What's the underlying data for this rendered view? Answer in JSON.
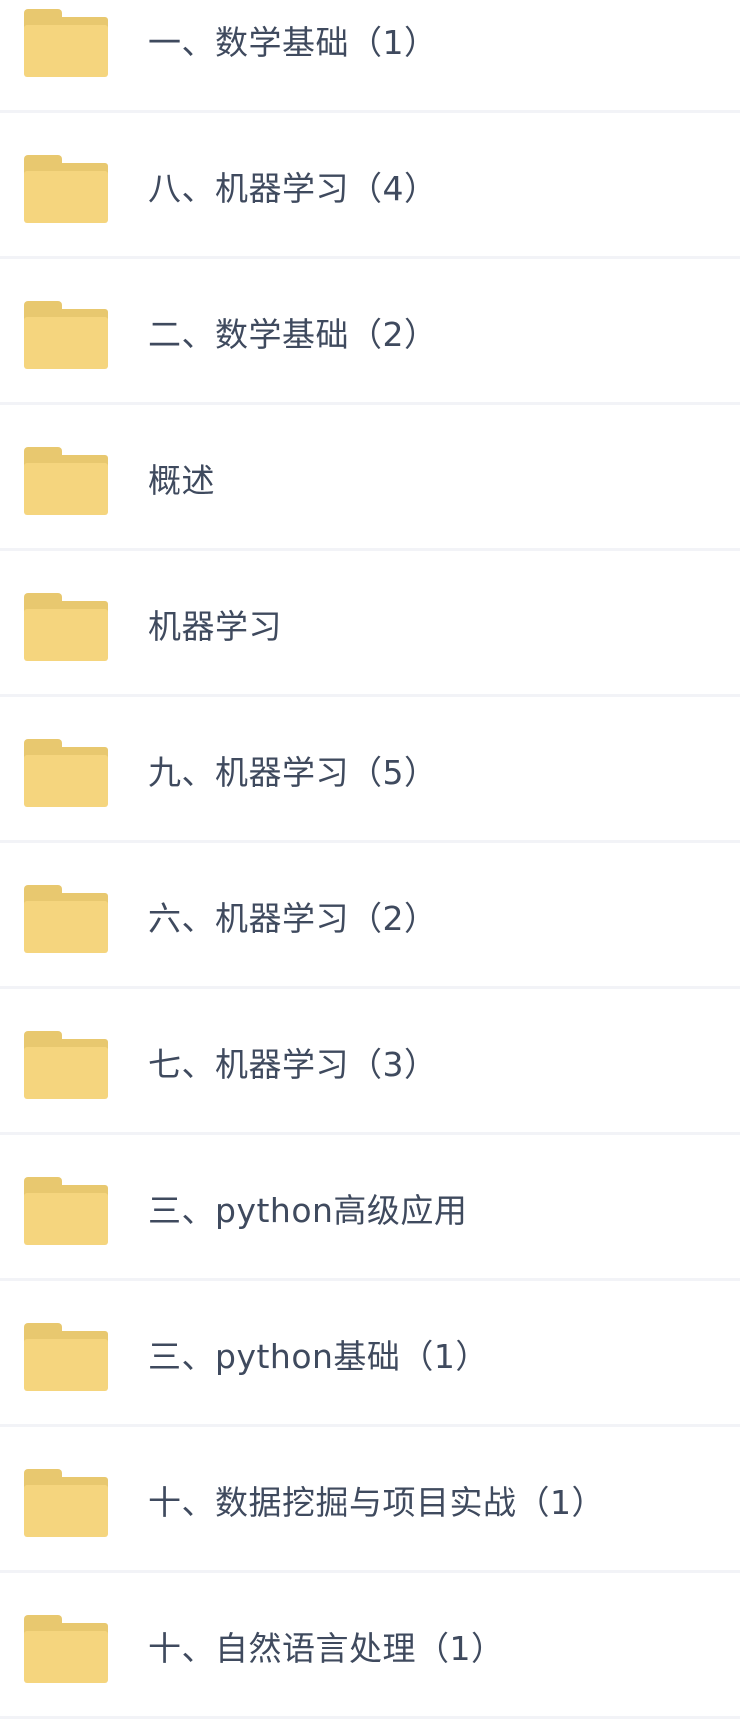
{
  "folders": [
    {
      "name": "一、数学基础（1）"
    },
    {
      "name": "八、机器学习（4）"
    },
    {
      "name": "二、数学基础（2）"
    },
    {
      "name": "概述"
    },
    {
      "name": "机器学习"
    },
    {
      "name": "九、机器学习（5）"
    },
    {
      "name": "六、机器学习（2）"
    },
    {
      "name": "七、机器学习（3）"
    },
    {
      "name": "三、python高级应用"
    },
    {
      "name": "三、python基础（1）"
    },
    {
      "name": "十、数据挖掘与项目实战（1）"
    },
    {
      "name": "十、自然语言处理（1）"
    }
  ],
  "colors": {
    "folder_body": "#f5d57e",
    "folder_back": "#e8c86f",
    "text": "#3f4a5e",
    "divider": "#f2f3f7"
  },
  "icons": {
    "folder": "folder-icon"
  }
}
